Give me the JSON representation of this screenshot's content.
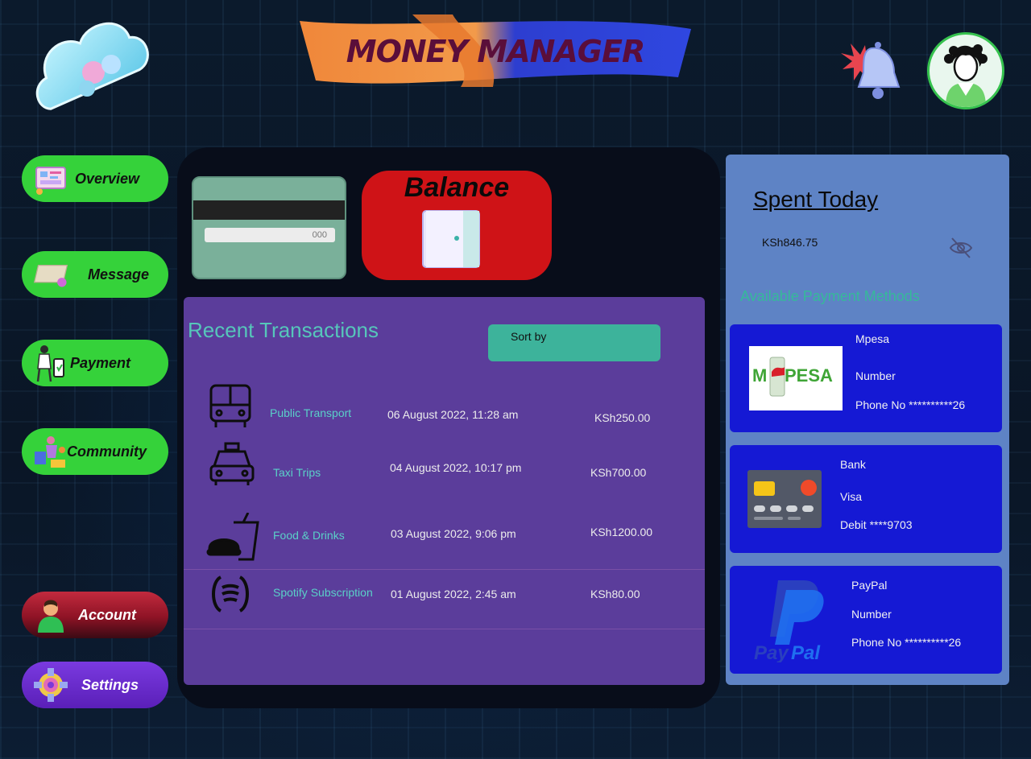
{
  "header": {
    "title": "MONEY MANAGER"
  },
  "sidebar": {
    "items": [
      {
        "label": "Overview"
      },
      {
        "label": "Message"
      },
      {
        "label": "Payment"
      },
      {
        "label": "Community"
      },
      {
        "label": "Account"
      },
      {
        "label": "Settings"
      }
    ]
  },
  "card": {
    "code": "000"
  },
  "balance": {
    "label": "Balance"
  },
  "transactions": {
    "title": "Recent Transactions",
    "sort_label": "Sort by",
    "rows": [
      {
        "icon": "bus-icon",
        "name": "Public Transport",
        "date": "06 August 2022, 11:28 am",
        "amount": "KSh250.00"
      },
      {
        "icon": "taxi-icon",
        "name": "Taxi Trips",
        "date": "04 August 2022, 10:17 pm",
        "amount": "KSh700.00"
      },
      {
        "icon": "food-drink-icon",
        "name": "Food & Drinks",
        "date": "03 August 2022, 9:06  pm",
        "amount": "KSh1200.00"
      },
      {
        "icon": "spotify-icon",
        "name": "Spotify Subscription",
        "date": "01 August 2022, 2:45 am",
        "amount": "KSh80.00"
      }
    ]
  },
  "spent_today": {
    "title": "Spent Today",
    "amount": "KSh846.75"
  },
  "payment_methods": {
    "title": "Available Payment Methods",
    "items": [
      {
        "name": "Mpesa",
        "type": "Number",
        "detail": "Phone No **********26",
        "logo_text": "M PESA"
      },
      {
        "name": "Bank",
        "type": "Visa",
        "detail": "Debit ****9703"
      },
      {
        "name": "PayPal",
        "type": "Number",
        "detail": "Phone No **********26",
        "logo_text": "PayPal"
      }
    ]
  },
  "colors": {
    "nav_green": "#35d23a",
    "balance_red": "#cf1317",
    "transactions_bg": "#5b3d9b",
    "right_panel_bg": "#5e83c5",
    "method_card_bg": "#1519d4",
    "accent_teal": "#3db39b"
  }
}
